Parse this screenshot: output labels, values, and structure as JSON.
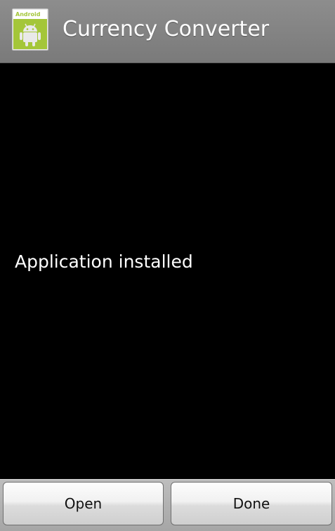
{
  "title_bar": {
    "title": "Currency Converter",
    "icon": {
      "name": "android-app-icon",
      "label": "Android",
      "colors": {
        "body": "#a4c639",
        "header": "#ffffff",
        "frame": "#e9e9e9"
      }
    }
  },
  "main": {
    "status_message": "Application installed"
  },
  "buttons": {
    "open_label": "Open",
    "done_label": "Done"
  },
  "colors": {
    "title_bar_bg": "#858585",
    "content_bg": "#000000",
    "text": "#ffffff",
    "button_bar_bg": "#b0b0b0"
  }
}
